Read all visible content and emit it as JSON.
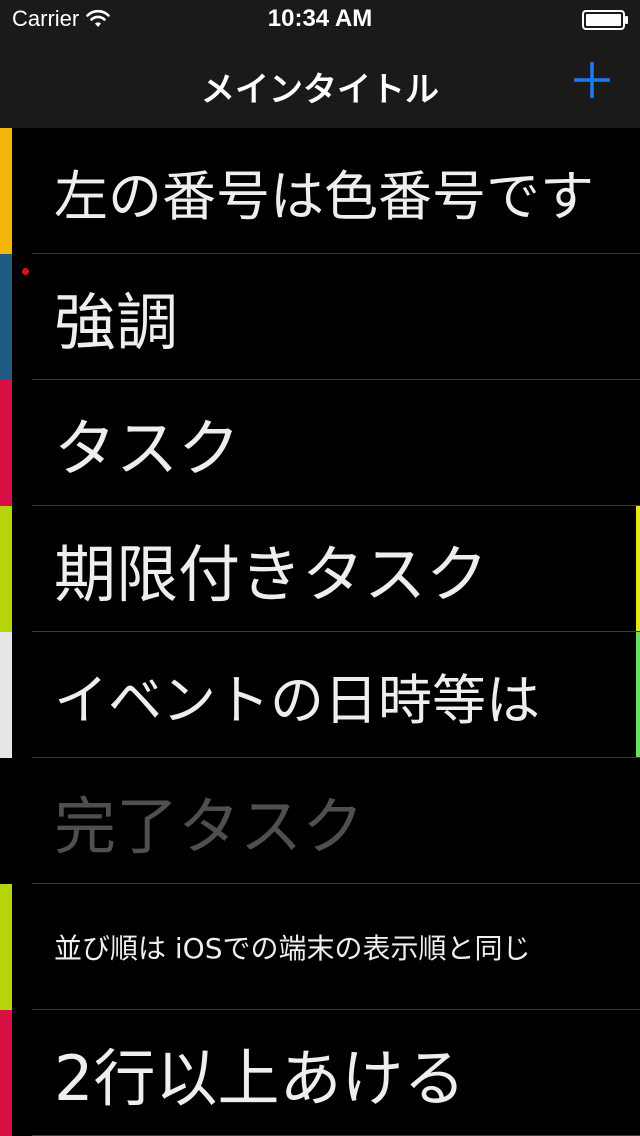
{
  "status_bar": {
    "carrier": "Carrier",
    "time": "10:34 AM",
    "wifi_icon": "wifi-icon",
    "battery_icon": "battery-icon"
  },
  "nav": {
    "title": "メインタイトル",
    "add_icon": "plus-icon",
    "accent_color": "#1a7cf5"
  },
  "tasks": [
    {
      "label": "左の番号は色番号です",
      "color": "#f5b50a",
      "size": "lg",
      "done": false
    },
    {
      "label": "強調",
      "color": "#1f5c82",
      "size": "xl",
      "done": false,
      "emphasis_dot": "#dd1111"
    },
    {
      "label": "タスク",
      "color": "#d90f45",
      "size": "xl",
      "done": false
    },
    {
      "label": "期限付きタスク",
      "color": "#b8d40b",
      "size": "xl",
      "done": false,
      "right_accent": "#e6e61a"
    },
    {
      "label": "イベントの日時等は",
      "color": "#e6e6e6",
      "size": "lg",
      "done": false,
      "right_accent": "#66e066"
    },
    {
      "label": "完了タスク",
      "color": "#000000",
      "size": "xl",
      "done": true
    },
    {
      "label": "並び順は iOSでの端末の表示順と同じ",
      "color": "#b8d40b",
      "size": "sm",
      "done": false
    },
    {
      "label": "2行以上あける",
      "color": "#d90f45",
      "size": "xl",
      "done": false
    }
  ]
}
